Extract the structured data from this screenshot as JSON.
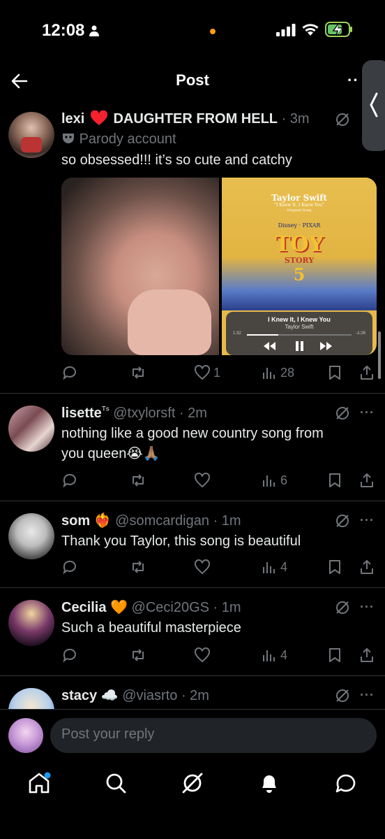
{
  "status_bar": {
    "time": "12:08"
  },
  "header": {
    "title": "Post"
  },
  "main_post": {
    "author": "lexi",
    "display_rest": "DAUGHTER FROM HELL",
    "handle_time": "· 3m",
    "label": "Parody account",
    "text": "so obsessed!!! it’s so cute and catchy",
    "media": {
      "poster_artist": "Taylor Swift",
      "poster_song": "\"I Knew It, I Knew You\"",
      "poster_sub": "Original Song",
      "poster_brand": "Disney · PIXAR",
      "poster_logo_1": "TOY",
      "poster_logo_2": "STORY",
      "poster_logo_3": "5",
      "player_title": "I Knew It, I Knew You",
      "player_artist": "Taylor Swift",
      "player_elapsed": "1:32",
      "player_remaining": "-1:26",
      "player_progress": 0.3
    },
    "likes": "1",
    "views": "28"
  },
  "replies": [
    {
      "name": "lisette",
      "name_suffix": "ᵀˢ",
      "handle_time": "@txylorsft · 2m",
      "text_1": "nothing like a good new country song from",
      "text_2": "you queen😭🙏🏽",
      "views": "6"
    },
    {
      "name": "som",
      "name_suffix": "❤️‍🔥",
      "handle_time": "@somcardigan · 1m",
      "text_1": "Thank you Taylor, this song is beautiful",
      "views": "4"
    },
    {
      "name": "Cecilia",
      "name_suffix": "🧡",
      "handle_time": "@Ceci20GS · 1m",
      "text_1": "Such a beautiful masterpiece",
      "views": "4"
    },
    {
      "name": "stacy",
      "name_suffix": "☁️",
      "handle_time": "@viasrto · 2m"
    }
  ],
  "reply_input": {
    "placeholder": "Post your reply"
  },
  "icons": {
    "back": "arrow-left-icon",
    "grok": "grok-icon",
    "reply": "reply-icon",
    "repost": "repost-icon",
    "like": "heart-icon",
    "views": "views-icon",
    "bookmark": "bookmark-icon",
    "share": "share-icon",
    "home": "home-icon",
    "search": "search-icon",
    "notifications": "bell-icon",
    "messages": "messages-icon"
  },
  "colors": {
    "background": "#000000",
    "text": "#e7e9ea",
    "secondary": "#71767b",
    "divider": "#2f3336",
    "heart": "#f4212e",
    "accent": "#1d9bf0"
  }
}
